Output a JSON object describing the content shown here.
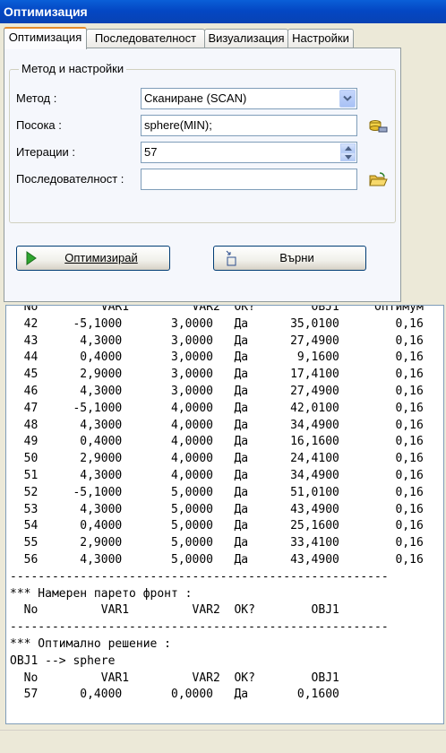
{
  "window": {
    "title": "Оптимизация"
  },
  "tabs": [
    {
      "label": "Оптимизация"
    },
    {
      "label": "Последователност"
    },
    {
      "label": "Визуализация"
    },
    {
      "label": "Настройки"
    }
  ],
  "group": {
    "label": "Метод и настройки"
  },
  "form": {
    "method_label": "Метод :",
    "method_value": "Сканиране (SCAN)",
    "direction_label": "Посока :",
    "direction_value": "sphere(MIN);",
    "iterations_label": "Итерации :",
    "iterations_value": "57",
    "sequence_label": "Последователност :",
    "sequence_value": ""
  },
  "buttons": {
    "optimize": "Оптимизирай",
    "back": "Върни"
  },
  "output": {
    "lines": [
      "  No         VAR1         VAR2  OK?        OBJ1     Оптимум",
      "  42     -5,1000       3,0000   Да      35,0100        0,16",
      "  43      4,3000       3,0000   Да      27,4900        0,16",
      "  44      0,4000       3,0000   Да       9,1600        0,16",
      "  45      2,9000       3,0000   Да      17,4100        0,16",
      "  46      4,3000       3,0000   Да      27,4900        0,16",
      "  47     -5,1000       4,0000   Да      42,0100        0,16",
      "  48      4,3000       4,0000   Да      34,4900        0,16",
      "  49      0,4000       4,0000   Да      16,1600        0,16",
      "  50      2,9000       4,0000   Да      24,4100        0,16",
      "  51      4,3000       4,0000   Да      34,4900        0,16",
      "  52     -5,1000       5,0000   Да      51,0100        0,16",
      "  53      4,3000       5,0000   Да      43,4900        0,16",
      "  54      0,4000       5,0000   Да      25,1600        0,16",
      "  55      2,9000       5,0000   Да      33,4100        0,16",
      "  56      4,3000       5,0000   Да      43,4900        0,16",
      "------------------------------------------------------",
      "*** Намерен парето фронт :",
      "  No         VAR1         VAR2  OK?        OBJ1",
      "------------------------------------------------------",
      "*** Оптимално решение :",
      "OBJ1 --> sphere",
      "  No         VAR1         VAR2  OK?        OBJ1",
      "  57      0,4000       0,0000   Да       0,1600               0,16"
    ]
  },
  "colors": {
    "titlebar": "#0a5fd8",
    "tab_highlight": "#e68b2c",
    "panel_bg": "#f5f7fc",
    "window_bg": "#ece9d8",
    "play_icon": "#2fa52f"
  }
}
